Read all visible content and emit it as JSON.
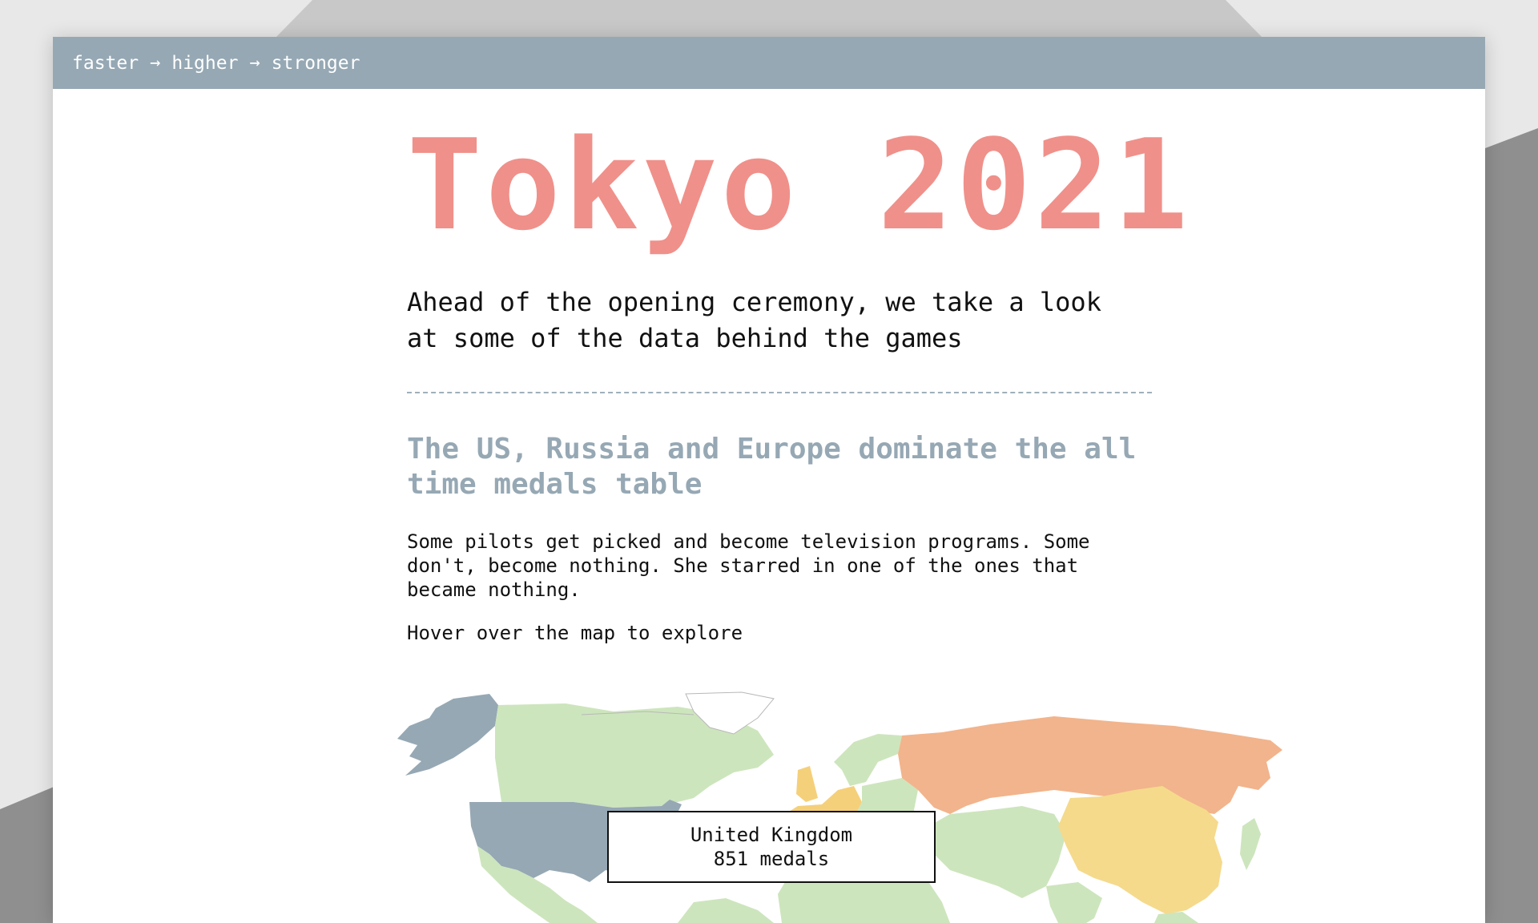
{
  "nav": {
    "items": [
      "faster",
      "higher",
      "stronger"
    ],
    "separator": "→"
  },
  "header": {
    "title": "Tokyo 2021",
    "lead_line1": "Ahead of the opening ceremony, we take a look",
    "lead_line2": "at some of the data behind the games"
  },
  "section": {
    "heading": "The US, Russia and Europe dominate the all time medals table",
    "body": "Some pilots get picked and become television programs. Some\ndon't, become nothing. She starred in one of the ones that\nbecame nothing.",
    "hint": "Hover over the map to explore"
  },
  "map": {
    "tooltip": {
      "country": "United Kingdom",
      "medals": "851 medals"
    },
    "highlighted_regions": [
      {
        "name": "United States",
        "color": "#96a8b4"
      },
      {
        "name": "Russia",
        "color": "#f2b48c"
      },
      {
        "name": "China",
        "color": "#f5da8c"
      },
      {
        "name": "Europe",
        "color": "#f5d07a"
      }
    ]
  },
  "colors": {
    "topbar": "#96a8b4",
    "title": "#f0908a",
    "heading": "#96a8b4",
    "map_default": "#cde5bd",
    "map_usa": "#96a8b4",
    "map_russia": "#f2b48c",
    "map_china": "#f5da8c",
    "map_europe": "#f5d07a"
  }
}
